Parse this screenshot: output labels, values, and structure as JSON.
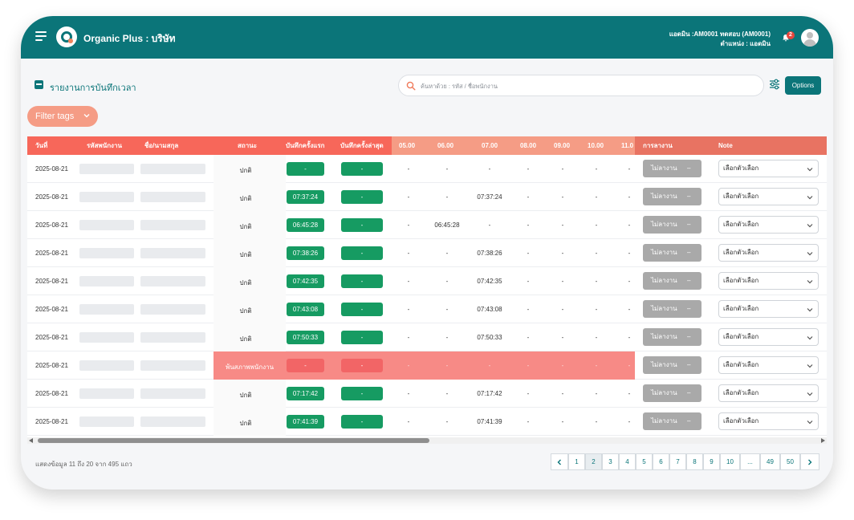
{
  "header": {
    "brand": "Organic Plus : บริษัท",
    "user_line1": "แอดมิน :AM0001 ทดสอบ (AM0001)",
    "user_line2": "ตำแหน่ง : แอดมิน",
    "notification_count": "2"
  },
  "toolbar": {
    "page_title": "รายงานการบันทึกเวลา",
    "search_placeholder": "ค้นหาด้วย : รหัส / ชื่อพนักงาน",
    "options_label": "Options",
    "filter_tags_label": "Filter tags"
  },
  "table": {
    "columns": {
      "date": "วันที่",
      "emp_code": "รหัสพนักงาน",
      "name": "ชื่อ/นามสกุล",
      "status": "สถานะ",
      "first_record": "บันทึกครั้งแรก",
      "last_record": "บันทึกครั้งล่าสุด",
      "h05": "05.00",
      "h06": "06.00",
      "h07": "07.00",
      "h08": "08.00",
      "h09": "09.00",
      "h10": "10.00",
      "h11": "11.0",
      "leave": "การลางาน",
      "note": "Note"
    },
    "rows": [
      {
        "date": "2025-08-21",
        "status": "ปกติ",
        "first": "-",
        "last": "-",
        "h05": "-",
        "h06": "-",
        "h07": "-",
        "h08": "-",
        "h09": "-",
        "h10": "-",
        "h11": "-",
        "leave": "ไม่ลางาน",
        "leave_dash": "–",
        "note": "เลือกตัวเลือก"
      },
      {
        "date": "2025-08-21",
        "status": "ปกติ",
        "first": "07:37:24",
        "last": "-",
        "h05": "-",
        "h06": "-",
        "h07": "07:37:24",
        "h08": "-",
        "h09": "-",
        "h10": "-",
        "h11": "-",
        "leave": "ไม่ลางาน",
        "leave_dash": "–",
        "note": "เลือกตัวเลือก"
      },
      {
        "date": "2025-08-21",
        "status": "ปกติ",
        "first": "06:45:28",
        "last": "-",
        "h05": "-",
        "h06": "06:45:28",
        "h07": "-",
        "h08": "-",
        "h09": "-",
        "h10": "-",
        "h11": "-",
        "leave": "ไม่ลางาน",
        "leave_dash": "–",
        "note": "เลือกตัวเลือก"
      },
      {
        "date": "2025-08-21",
        "status": "ปกติ",
        "first": "07:38:26",
        "last": "-",
        "h05": "-",
        "h06": "-",
        "h07": "07:38:26",
        "h08": "-",
        "h09": "-",
        "h10": "-",
        "h11": "-",
        "leave": "ไม่ลางาน",
        "leave_dash": "–",
        "note": "เลือกตัวเลือก"
      },
      {
        "date": "2025-08-21",
        "status": "ปกติ",
        "first": "07:42:35",
        "last": "-",
        "h05": "-",
        "h06": "-",
        "h07": "07:42:35",
        "h08": "-",
        "h09": "-",
        "h10": "-",
        "h11": "-",
        "leave": "ไม่ลางาน",
        "leave_dash": "–",
        "note": "เลือกตัวเลือก"
      },
      {
        "date": "2025-08-21",
        "status": "ปกติ",
        "first": "07:43:08",
        "last": "-",
        "h05": "-",
        "h06": "-",
        "h07": "07:43:08",
        "h08": "-",
        "h09": "-",
        "h10": "-",
        "h11": "-",
        "leave": "ไม่ลางาน",
        "leave_dash": "–",
        "note": "เลือกตัวเลือก"
      },
      {
        "date": "2025-08-21",
        "status": "ปกติ",
        "first": "07:50:33",
        "last": "-",
        "h05": "-",
        "h06": "-",
        "h07": "07:50:33",
        "h08": "-",
        "h09": "-",
        "h10": "-",
        "h11": "-",
        "leave": "ไม่ลางาน",
        "leave_dash": "–",
        "note": "เลือกตัวเลือก"
      },
      {
        "date": "2025-08-21",
        "status": "พ้นสภาพพนักงาน",
        "first": "-",
        "last": "-",
        "h05": "-",
        "h06": "-",
        "h07": "-",
        "h08": "-",
        "h09": "-",
        "h10": "-",
        "h11": "-",
        "leave": "ไม่ลางาน",
        "leave_dash": "–",
        "note": "เลือกตัวเลือก",
        "inactive": true
      },
      {
        "date": "2025-08-21",
        "status": "ปกติ",
        "first": "07:17:42",
        "last": "-",
        "h05": "-",
        "h06": "-",
        "h07": "07:17:42",
        "h08": "-",
        "h09": "-",
        "h10": "-",
        "h11": "-",
        "leave": "ไม่ลางาน",
        "leave_dash": "–",
        "note": "เลือกตัวเลือก"
      },
      {
        "date": "2025-08-21",
        "status": "ปกติ",
        "first": "07:41:39",
        "last": "-",
        "h05": "-",
        "h06": "-",
        "h07": "07:41:39",
        "h08": "-",
        "h09": "-",
        "h10": "-",
        "h11": "-",
        "leave": "ไม่ลางาน",
        "leave_dash": "–",
        "note": "เลือกตัวเลือก"
      }
    ]
  },
  "footer": {
    "summary": "แสดงข้อมูล 11 ถึง 20 จาก 495 แถว",
    "pages": [
      "1",
      "2",
      "3",
      "4",
      "5",
      "6",
      "7",
      "8",
      "9",
      "10",
      "...",
      "49",
      "50"
    ],
    "active_page": "2"
  },
  "colors": {
    "brand": "#0b7579",
    "header_row": "#f7675a",
    "header_hours": "#f59c85",
    "header_right": "#e87362",
    "success": "#169b62",
    "inactive_row": "#f78a86",
    "inactive_pill": "#f26566",
    "leave_button": "#a9a9a9"
  }
}
